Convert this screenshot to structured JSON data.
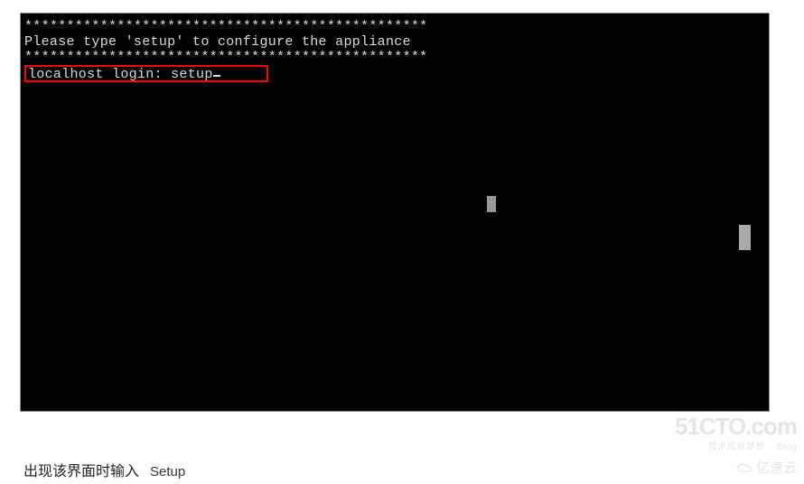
{
  "terminal": {
    "line1": "************************************************",
    "line2": "Please type 'setup' to configure the appliance",
    "line3": "************************************************",
    "login_prompt": "localhost login: ",
    "login_value": "setup"
  },
  "caption": {
    "cn_text": "出现该界面时输入",
    "en_text": "Setup"
  },
  "watermark": {
    "main": "51CTO.com",
    "sub_left": "技术成就梦想",
    "sub_right": "Blog",
    "secondary": "亿速云"
  }
}
